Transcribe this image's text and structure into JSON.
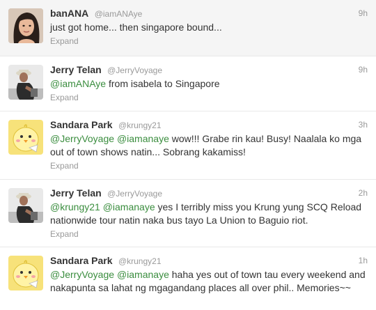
{
  "tweets": [
    {
      "name": "banANA",
      "handle": "@iamANAye",
      "time": "9h",
      "mentions": [],
      "text": "just got home... then singapore bound...",
      "expand": "Expand",
      "avatar": "woman-portrait"
    },
    {
      "name": "Jerry Telan",
      "handle": "@JerryVoyage",
      "time": "9h",
      "mentions": [
        "@iamANAye"
      ],
      "text": "from isabela to Singapore",
      "expand": "Expand",
      "avatar": "man-with-hat"
    },
    {
      "name": "Sandara Park",
      "handle": "@krungy21",
      "time": "3h",
      "mentions": [
        "@JerryVoyage",
        "@iamanaye"
      ],
      "text": "wow!!! Grabe rin kau! Busy! Naalala ko mga out of town shows natin... Sobrang kakamiss!",
      "expand": "Expand",
      "avatar": "yellow-chick"
    },
    {
      "name": "Jerry Telan",
      "handle": "@JerryVoyage",
      "time": "2h",
      "mentions": [
        "@krungy21",
        "@iamanaye"
      ],
      "text": "yes I terribly miss you Krung yung SCQ Reload nationwide tour natin naka bus tayo La Union to Baguio riot.",
      "expand": "Expand",
      "avatar": "man-with-hat"
    },
    {
      "name": "Sandara Park",
      "handle": "@krungy21",
      "time": "1h",
      "mentions": [
        "@JerryVoyage",
        "@iamanaye"
      ],
      "text": "haha yes out of town tau every weekend and nakapunta sa lahat ng mgagandang places all over phil.. Memories~~",
      "expand": "",
      "avatar": "yellow-chick"
    }
  ],
  "colors": {
    "mention": "#3a8d3e",
    "name": "#333333",
    "meta": "#999999",
    "row_highlight": "#f5f5f5"
  }
}
